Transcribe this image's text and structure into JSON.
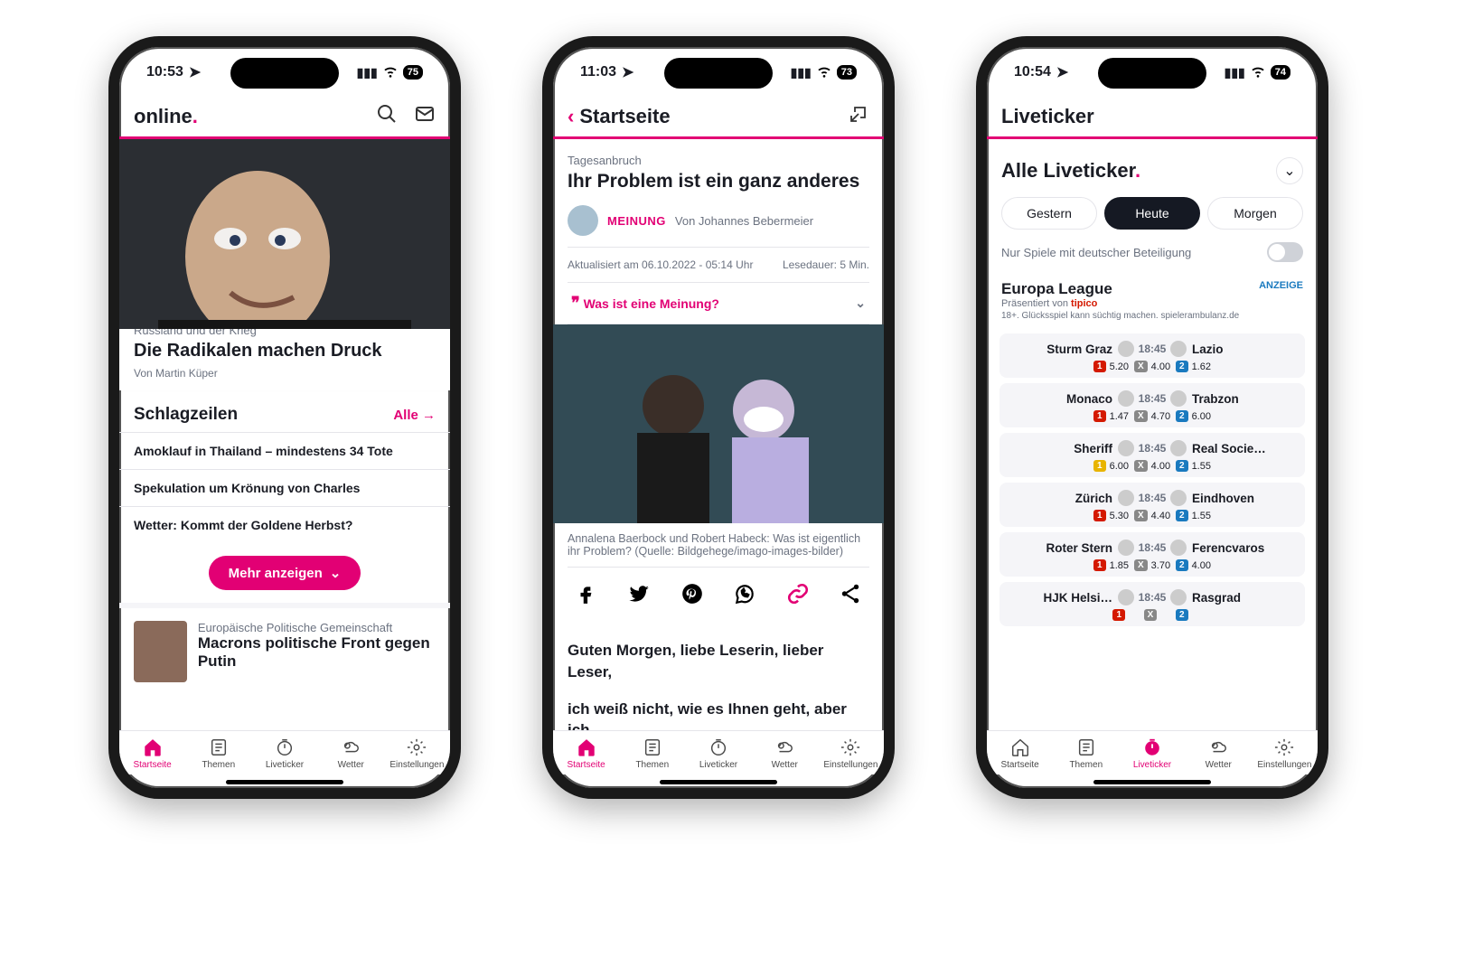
{
  "phone1": {
    "status": {
      "time": "10:53",
      "battery": "75"
    },
    "header": {
      "title": "online"
    },
    "hero": {
      "kicker": "Russland und der Krieg",
      "title": "Die Radikalen machen Druck",
      "byline": "Von Martin Küper"
    },
    "section": {
      "title": "Schlagzeilen",
      "all": "Alle"
    },
    "headlines": [
      "Amoklauf in Thailand – mindestens 34 Tote",
      "Spekulation um Krönung von Charles",
      "Wetter: Kommt der Goldene Herbst?"
    ],
    "more": "Mehr anzeigen",
    "teaser": {
      "kicker": "Europäische Politische Gemeinschaft",
      "title": "Macrons politische Front gegen Putin"
    }
  },
  "phone2": {
    "status": {
      "time": "11:03",
      "battery": "73"
    },
    "header": {
      "back": "Startseite"
    },
    "article": {
      "tag": "Tagesanbruch",
      "headline": "Ihr Problem ist ein ganz anderes",
      "opinion": "MEINUNG",
      "author": "Von Johannes Bebermeier",
      "updated": "Aktualisiert am 06.10.2022 - 05:14 Uhr",
      "reading": "Lesedauer: 5 Min.",
      "meinung_q": "Was ist eine Meinung?",
      "caption": "Annalena Baerbock und Robert Habeck: Was ist eigentlich ihr Problem? (Quelle: Bildgehege/imago-images-bilder)",
      "body1": "Guten Morgen, liebe Leserin, lieber Leser,",
      "body2": "ich weiß nicht, wie es Ihnen geht, aber ich"
    }
  },
  "phone3": {
    "status": {
      "time": "10:54",
      "battery": "74"
    },
    "header": {
      "title": "Liveticker"
    },
    "lt_title": "Alle Liveticker",
    "seg": {
      "yesterday": "Gestern",
      "today": "Heute",
      "tomorrow": "Morgen"
    },
    "toggle": "Nur Spiele mit deutscher Beteiligung",
    "league": {
      "name": "Europa League",
      "presented": "Präsentiert von",
      "sponsor": "tipico",
      "ad": "ANZEIGE"
    },
    "disclaimer": "18+. Glücksspiel kann süchtig machen. spielerambulanz.de",
    "matches": [
      {
        "home": "Sturm Graz",
        "away": "Lazio",
        "time": "18:45",
        "o1": "5.20",
        "ox": "4.00",
        "o2": "1.62"
      },
      {
        "home": "Monaco",
        "away": "Trabzon",
        "time": "18:45",
        "o1": "1.47",
        "ox": "4.70",
        "o2": "6.00"
      },
      {
        "home": "Sheriff",
        "away": "Real Socie…",
        "time": "18:45",
        "o1": "6.00",
        "ox": "4.00",
        "o2": "1.55",
        "yellow": true
      },
      {
        "home": "Zürich",
        "away": "Eindhoven",
        "time": "18:45",
        "o1": "5.30",
        "ox": "4.40",
        "o2": "1.55"
      },
      {
        "home": "Roter Stern",
        "away": "Ferencvaros",
        "time": "18:45",
        "o1": "1.85",
        "ox": "3.70",
        "o2": "4.00"
      },
      {
        "home": "HJK Helsi…",
        "away": "Rasgrad",
        "time": "18:45",
        "o1": "",
        "ox": "",
        "o2": ""
      }
    ]
  },
  "nav": {
    "items": [
      "Startseite",
      "Themen",
      "Liveticker",
      "Wetter",
      "Einstellungen"
    ]
  }
}
